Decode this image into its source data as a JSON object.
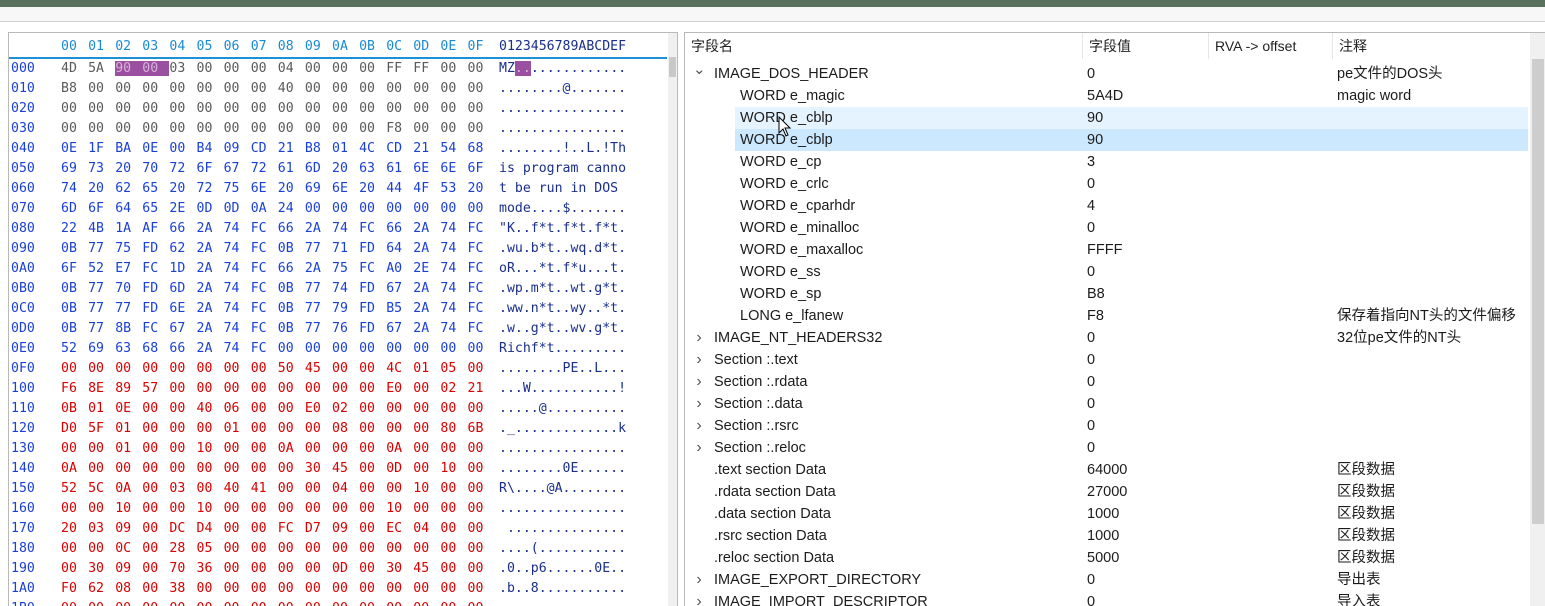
{
  "colors": {
    "offset": "#1a3fd6",
    "hex_black": "#5a5a5a",
    "hex_red": "#d80000",
    "ascii": "#1a2e8a",
    "header": "#1a8ad4"
  },
  "hex": {
    "header_bytes": [
      "00",
      "01",
      "02",
      "03",
      "04",
      "05",
      "06",
      "07",
      "08",
      "09",
      "0A",
      "0B",
      "0C",
      "0D",
      "0E",
      "0F"
    ],
    "header_ascii": "0123456789ABCDEF",
    "rows": [
      {
        "off": "000",
        "bytes": "4D 5A 90 00 03 00 00 00 04 00 00 00 FF FF 00 00",
        "ascii": "MZ..............",
        "color": "black",
        "hl": [
          2,
          3
        ]
      },
      {
        "off": "010",
        "bytes": "B8 00 00 00 00 00 00 00 40 00 00 00 00 00 00 00",
        "ascii": "........@.......",
        "color": "black"
      },
      {
        "off": "020",
        "bytes": "00 00 00 00 00 00 00 00 00 00 00 00 00 00 00 00",
        "ascii": "................",
        "color": "black"
      },
      {
        "off": "030",
        "bytes": "00 00 00 00 00 00 00 00 00 00 00 00 F8 00 00 00",
        "ascii": "................",
        "color": "black"
      },
      {
        "off": "040",
        "bytes": "0E 1F BA 0E 00 B4 09 CD 21 B8 01 4C CD 21 54 68",
        "ascii": "........!..L.!Th",
        "color": "blue"
      },
      {
        "off": "050",
        "bytes": "69 73 20 70 72 6F 67 72 61 6D 20 63 61 6E 6E 6F",
        "ascii": "is program canno",
        "color": "blue"
      },
      {
        "off": "060",
        "bytes": "74 20 62 65 20 72 75 6E 20 69 6E 20 44 4F 53 20",
        "ascii": "t be run in DOS ",
        "color": "blue"
      },
      {
        "off": "070",
        "bytes": "6D 6F 64 65 2E 0D 0D 0A 24 00 00 00 00 00 00 00",
        "ascii": "mode....$.......",
        "color": "blue"
      },
      {
        "off": "080",
        "bytes": "22 4B 1A AF 66 2A 74 FC 66 2A 74 FC 66 2A 74 FC",
        "ascii": "\"K..f*t.f*t.f*t.",
        "color": "blue"
      },
      {
        "off": "090",
        "bytes": "0B 77 75 FD 62 2A 74 FC 0B 77 71 FD 64 2A 74 FC",
        "ascii": ".wu.b*t..wq.d*t.",
        "color": "blue"
      },
      {
        "off": "0A0",
        "bytes": "6F 52 E7 FC 1D 2A 74 FC 66 2A 75 FC A0 2E 74 FC",
        "ascii": "oR...*t.f*u...t.",
        "color": "blue"
      },
      {
        "off": "0B0",
        "bytes": "0B 77 70 FD 6D 2A 74 FC 0B 77 74 FD 67 2A 74 FC",
        "ascii": ".wp.m*t..wt.g*t.",
        "color": "blue"
      },
      {
        "off": "0C0",
        "bytes": "0B 77 77 FD 6E 2A 74 FC 0B 77 79 FD B5 2A 74 FC",
        "ascii": ".ww.n*t..wy..*t.",
        "color": "blue"
      },
      {
        "off": "0D0",
        "bytes": "0B 77 8B FC 67 2A 74 FC 0B 77 76 FD 67 2A 74 FC",
        "ascii": ".w..g*t..wv.g*t.",
        "color": "blue"
      },
      {
        "off": "0E0",
        "bytes": "52 69 63 68 66 2A 74 FC 00 00 00 00 00 00 00 00",
        "ascii": "Richf*t.........",
        "color": "blue"
      },
      {
        "off": "0F0",
        "bytes": "00 00 00 00 00 00 00 00 50 45 00 00 4C 01 05 00",
        "ascii": "........PE..L...",
        "color": "red"
      },
      {
        "off": "100",
        "bytes": "F6 8E 89 57 00 00 00 00 00 00 00 00 E0 00 02 21",
        "ascii": "...W...........!",
        "color": "red"
      },
      {
        "off": "110",
        "bytes": "0B 01 0E 00 00 40 06 00 00 E0 02 00 00 00 00 00",
        "ascii": ".....@..........",
        "color": "red"
      },
      {
        "off": "120",
        "bytes": "D0 5F 01 00 00 00 01 00 00 00 08 00 00 00 80 6B",
        "ascii": "._.............k",
        "color": "red"
      },
      {
        "off": "130",
        "bytes": "00 00 01 00 00 10 00 00 0A 00 00 00 0A 00 00 00",
        "ascii": "................",
        "color": "red"
      },
      {
        "off": "140",
        "bytes": "0A 00 00 00 00 00 00 00 00 30 45 00 0D 00 10 00 00",
        "ascii": "........0E......",
        "color": "red"
      },
      {
        "off": "150",
        "bytes": "52 5C 0A 00 03 00 40 41 00 00 04 00 00 10 00 00",
        "ascii": "R\\....@A........",
        "color": "red"
      },
      {
        "off": "160",
        "bytes": "00 00 10 00 00 10 00 00 00 00 00 00 10 00 00 00",
        "ascii": "................",
        "color": "red"
      },
      {
        "off": "170",
        "bytes": "20 03 09 00 DC D4 00 00 FC D7 09 00 EC 04 00 00",
        "ascii": " ...............",
        "color": "red"
      },
      {
        "off": "180",
        "bytes": "00 00 0C 00 28 05 00 00 00 00 00 00 00 00 00 00",
        "ascii": "....(...........",
        "color": "red"
      },
      {
        "off": "190",
        "bytes": "00 30 09 00 70 36 00 00 00 00 0D 00 30 45 00 00",
        "ascii": ".0..p6......0E..",
        "color": "red"
      },
      {
        "off": "1A0",
        "bytes": "F0 62 08 00 38 00 00 00 00 00 00 00 00 00 00 00",
        "ascii": ".b..8...........",
        "color": "red"
      },
      {
        "off": "1B0",
        "bytes": "00 00 00 00 00 00 00 00 00 00 00 00 00 00 00 00",
        "ascii": "................",
        "color": "red"
      }
    ]
  },
  "tree": {
    "columns": [
      "字段名",
      "字段值",
      "RVA -> offset",
      "注释"
    ],
    "rows": [
      {
        "indent": 0,
        "chev": "down",
        "name": "IMAGE_DOS_HEADER",
        "value": "0",
        "note": "pe文件的DOS头"
      },
      {
        "indent": 1,
        "chev": "",
        "name": "WORD e_magic",
        "value": "5A4D",
        "note": "magic word"
      },
      {
        "indent": 1,
        "chev": "",
        "name": "WORD e_cblp",
        "value": "90",
        "note": "",
        "sel": "hover"
      },
      {
        "indent": 1,
        "chev": "",
        "name": "WORD e_cblp",
        "value": "90",
        "note": "",
        "sel": "selected"
      },
      {
        "indent": 1,
        "chev": "",
        "name": "WORD e_cp",
        "value": "3",
        "note": ""
      },
      {
        "indent": 1,
        "chev": "",
        "name": "WORD e_crlc",
        "value": "0",
        "note": ""
      },
      {
        "indent": 1,
        "chev": "",
        "name": "WORD e_cparhdr",
        "value": "4",
        "note": ""
      },
      {
        "indent": 1,
        "chev": "",
        "name": "WORD e_minalloc",
        "value": "0",
        "note": ""
      },
      {
        "indent": 1,
        "chev": "",
        "name": "WORD e_maxalloc",
        "value": "FFFF",
        "note": ""
      },
      {
        "indent": 1,
        "chev": "",
        "name": "WORD e_ss",
        "value": "0",
        "note": ""
      },
      {
        "indent": 1,
        "chev": "",
        "name": "WORD e_sp",
        "value": "B8",
        "note": ""
      },
      {
        "indent": 1,
        "chev": "",
        "name": "LONG e_lfanew",
        "value": "F8",
        "note": "保存着指向NT头的文件偏移"
      },
      {
        "indent": 0,
        "chev": "right",
        "name": "IMAGE_NT_HEADERS32",
        "value": "0",
        "note": "32位pe文件的NT头"
      },
      {
        "indent": 0,
        "chev": "right",
        "name": "Section :.text",
        "value": "0",
        "note": ""
      },
      {
        "indent": 0,
        "chev": "right",
        "name": "Section :.rdata",
        "value": "0",
        "note": ""
      },
      {
        "indent": 0,
        "chev": "right",
        "name": "Section :.data",
        "value": "0",
        "note": ""
      },
      {
        "indent": 0,
        "chev": "right",
        "name": "Section :.rsrc",
        "value": "0",
        "note": ""
      },
      {
        "indent": 0,
        "chev": "right",
        "name": "Section :.reloc",
        "value": "0",
        "note": ""
      },
      {
        "indent": 0,
        "chev": "",
        "name": ".text section Data",
        "value": "64000",
        "note": "区段数据"
      },
      {
        "indent": 0,
        "chev": "",
        "name": ".rdata section Data",
        "value": "27000",
        "note": "区段数据"
      },
      {
        "indent": 0,
        "chev": "",
        "name": ".data section Data",
        "value": "1000",
        "note": "区段数据"
      },
      {
        "indent": 0,
        "chev": "",
        "name": ".rsrc section Data",
        "value": "1000",
        "note": "区段数据"
      },
      {
        "indent": 0,
        "chev": "",
        "name": ".reloc section Data",
        "value": "5000",
        "note": "区段数据"
      },
      {
        "indent": 0,
        "chev": "right",
        "name": "IMAGE_EXPORT_DIRECTORY",
        "value": "0",
        "note": "导出表"
      },
      {
        "indent": 0,
        "chev": "right",
        "name": "IMAGE_IMPORT_DESCRIPTOR",
        "value": "0",
        "note": "导入表"
      }
    ]
  }
}
